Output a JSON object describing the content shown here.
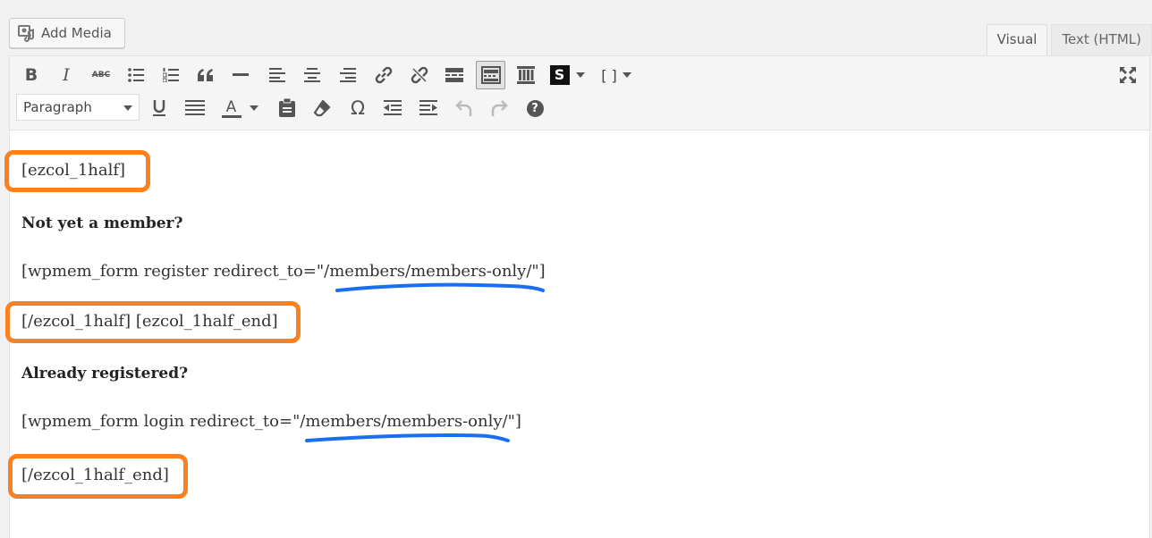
{
  "add_media": {
    "label": "Add Media",
    "icon": "media-icon"
  },
  "tabs": [
    {
      "label": "Visual",
      "active": true
    },
    {
      "label": "Text (HTML)",
      "active": false
    }
  ],
  "toolbar": {
    "row1": [
      "bold",
      "italic",
      "strikethrough",
      "bullet-list",
      "numbered-list",
      "blockquote",
      "horizontal-line",
      "align-left",
      "align-center",
      "align-right",
      "insert-link",
      "remove-link",
      "read-more",
      "toolbar-toggle",
      "columns",
      "shortcode-s",
      "shortcode-brackets",
      "fullscreen"
    ],
    "strike_glyph": "ABC",
    "brackets_glyph": "[ ]",
    "s_glyph": "S",
    "format_select": "Paragraph",
    "text_color_glyph": "A",
    "omega_glyph": "Ω",
    "help_glyph": "?"
  },
  "content": {
    "line1": "[ezcol_1half]",
    "heading1": "Not yet a member?",
    "line2": "[wpmem_form register redirect_to=\"/members/members-only/\"]",
    "line3": "[/ezcol_1half] [ezcol_1half_end]",
    "heading2": "Already registered?",
    "line4": "[wpmem_form login redirect_to=\"/members/members-only/\"]",
    "line5": "[/ezcol_1half_end]"
  },
  "annotations": {
    "box_color": "#fb8120",
    "underline_color": "#1a6ff0"
  }
}
